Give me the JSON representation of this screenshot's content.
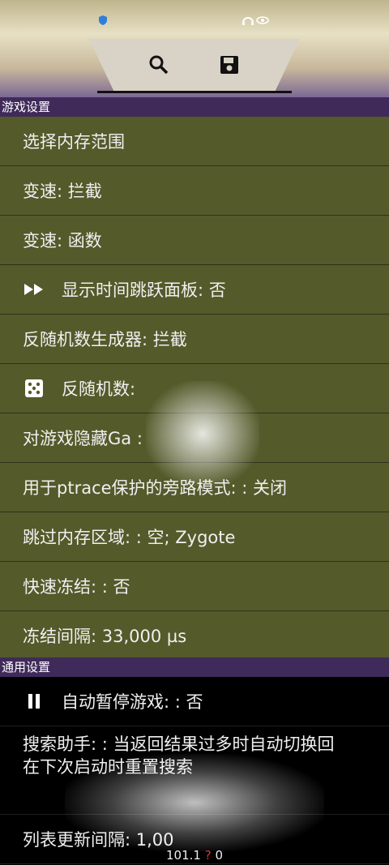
{
  "status_bar": {
    "left_icons": "shield",
    "right_icons": "headset eye"
  },
  "toolbar": {
    "search_icon": "search-icon",
    "save_icon": "save-icon"
  },
  "sections": [
    {
      "title": "游戏设置"
    },
    {
      "title": "通用设置"
    }
  ],
  "game_settings": [
    {
      "label": "选择内存范围",
      "icon": ""
    },
    {
      "label": "变速: 拦截",
      "icon": ""
    },
    {
      "label": "变速: 函数",
      "icon": ""
    },
    {
      "label": "显示时间跳跃面板: 否",
      "icon": "fast-forward-icon"
    },
    {
      "label": "反随机数生成器: 拦截",
      "icon": ""
    },
    {
      "label": "反随机数:",
      "icon": "dice-icon"
    },
    {
      "label": "对游戏隐藏Ga           :",
      "icon": ""
    },
    {
      "label": "用于ptrace保护的旁路模式: : 关闭",
      "icon": ""
    },
    {
      "label": "跳过内存区域: : 空; Zygote",
      "icon": ""
    },
    {
      "label": "快速冻结: : 否",
      "icon": ""
    },
    {
      "label": "冻结间隔:   33,000 µs",
      "icon": ""
    }
  ],
  "general_settings": [
    {
      "label": "自动暂停游戏: : 否",
      "icon": "pause-icon"
    },
    {
      "label_line1": "搜索助手: : 当返回结果过多时自动切换回",
      "label_line2": "        在下次启动时重置搜索"
    },
    {
      "label": "列表更新间隔:   1,00",
      "icon": ""
    }
  ],
  "footer": {
    "version": "101.1",
    "q": "?",
    "count": "0"
  }
}
